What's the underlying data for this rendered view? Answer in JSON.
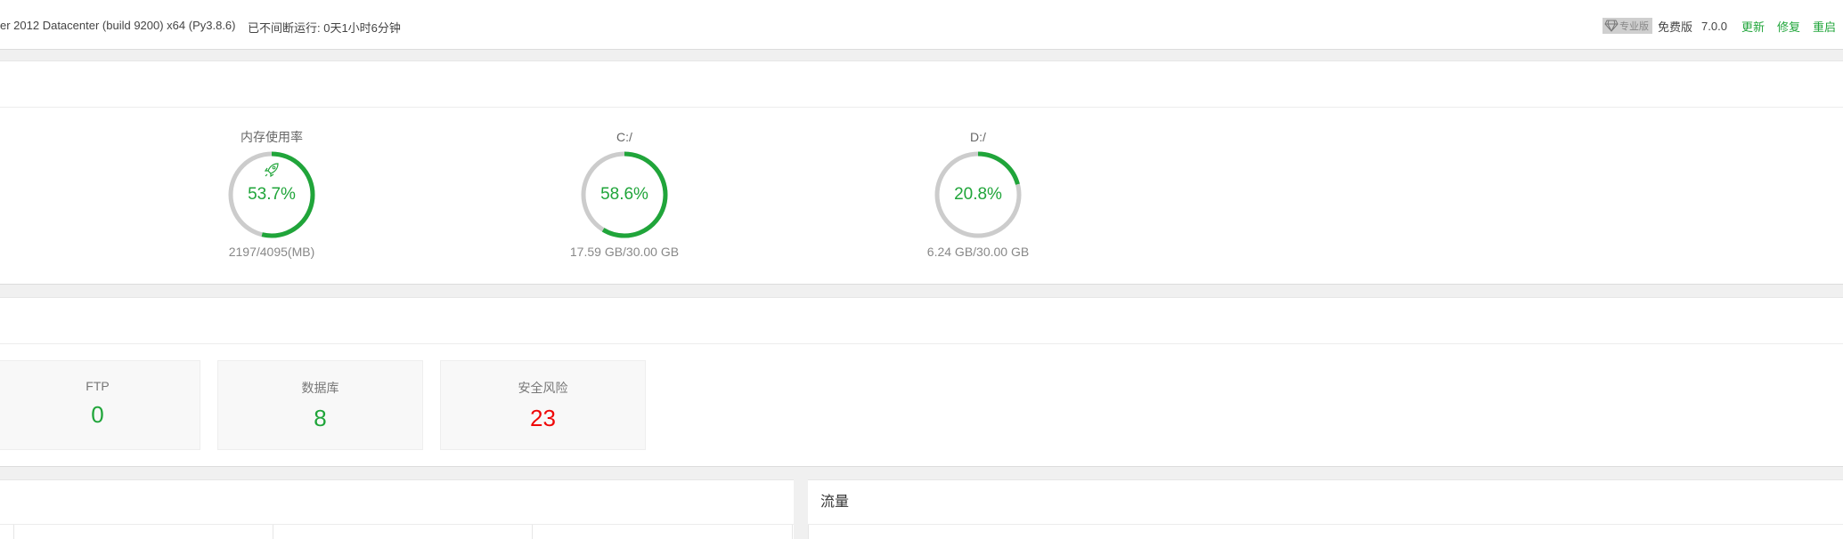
{
  "topbar": {
    "system_info": "er 2012 Datacenter (build 9200) x64 (Py3.8.6)",
    "uptime": "已不间断运行: 0天1小时6分钟",
    "pro_badge": "专业版",
    "free_label": "免费版",
    "version": "7.0.0",
    "links": [
      "更新",
      "修复",
      "重启"
    ]
  },
  "status": {
    "gauges": [
      {
        "title": "内存使用率",
        "value": "53.7%",
        "percent": 53.7,
        "sub": "2197/4095(MB)",
        "has_rocket": true
      },
      {
        "title": "C:/",
        "value": "58.6%",
        "percent": 58.6,
        "sub": "17.59 GB/30.00 GB",
        "has_rocket": false
      },
      {
        "title": "D:/",
        "value": "20.8%",
        "percent": 20.8,
        "sub": "6.24 GB/30.00 GB",
        "has_rocket": false
      }
    ]
  },
  "overview": {
    "cards": [
      {
        "label": "FTP",
        "value": "0"
      },
      {
        "label": "数据库",
        "value": "8"
      },
      {
        "label": "安全风险",
        "value": "23"
      }
    ]
  },
  "traffic": {
    "title": "流量"
  },
  "colors": {
    "accent": "#20a53a",
    "danger": "#ef0808",
    "ring_track": "#cccccc"
  }
}
